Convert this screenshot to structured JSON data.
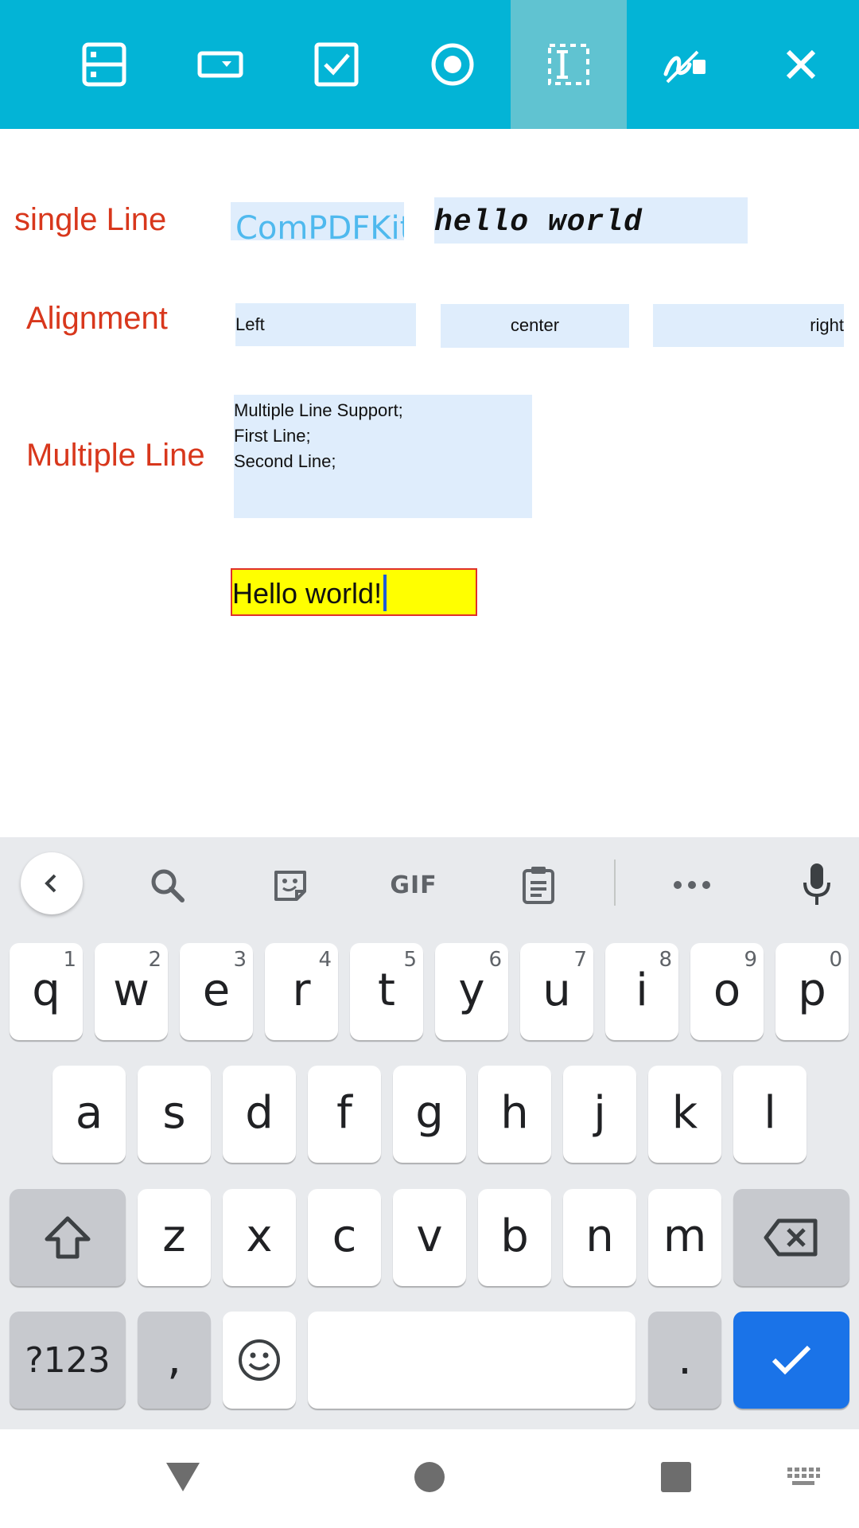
{
  "toolbar": {
    "background": "#03b4d6",
    "active_background": "#60c3d1",
    "tools": [
      {
        "icon": "form-list-icon"
      },
      {
        "icon": "combobox-icon"
      },
      {
        "icon": "checkbox-icon"
      },
      {
        "icon": "radio-button-icon"
      },
      {
        "icon": "text-field-icon",
        "active": true
      },
      {
        "icon": "signature-icon"
      },
      {
        "icon": "close-icon"
      }
    ]
  },
  "document": {
    "labels": {
      "single_line": "single Line",
      "alignment": "Alignment",
      "multiple_line": "Multiple Line"
    },
    "fields": {
      "compdfkit": "ComPDFKit",
      "hello_world": "hello world",
      "left": "Left",
      "center": "center",
      "right": "right",
      "multiline": "Multiple Line Support;\nFirst Line;\nSecond Line;",
      "active_value": "Hello world!"
    },
    "colors": {
      "label": "#d8371c",
      "field_bg": "#dfedfc",
      "compdfkit_text": "#4fb9ee",
      "active_bg": "#ffff00",
      "active_border": "#e0302a"
    }
  },
  "keyboard": {
    "toolbar_icons": [
      "back-icon",
      "search-icon",
      "sticker-icon",
      "gif-icon",
      "clipboard-icon",
      "more-icon",
      "microphone-icon"
    ],
    "gif_label": "GIF",
    "row1": [
      {
        "key": "q",
        "hint": "1"
      },
      {
        "key": "w",
        "hint": "2"
      },
      {
        "key": "e",
        "hint": "3"
      },
      {
        "key": "r",
        "hint": "4"
      },
      {
        "key": "t",
        "hint": "5"
      },
      {
        "key": "y",
        "hint": "6"
      },
      {
        "key": "u",
        "hint": "7"
      },
      {
        "key": "i",
        "hint": "8"
      },
      {
        "key": "o",
        "hint": "9"
      },
      {
        "key": "p",
        "hint": "0"
      }
    ],
    "row2": [
      "a",
      "s",
      "d",
      "f",
      "g",
      "h",
      "j",
      "k",
      "l"
    ],
    "row3": [
      "z",
      "x",
      "c",
      "v",
      "b",
      "n",
      "m"
    ],
    "symbols_label": "?123",
    "comma": ",",
    "period": ".",
    "enter_color": "#1a73e8"
  },
  "navbar": {
    "icons": [
      "back-triangle-icon",
      "home-circle-icon",
      "recents-square-icon",
      "keyboard-switch-icon"
    ]
  }
}
